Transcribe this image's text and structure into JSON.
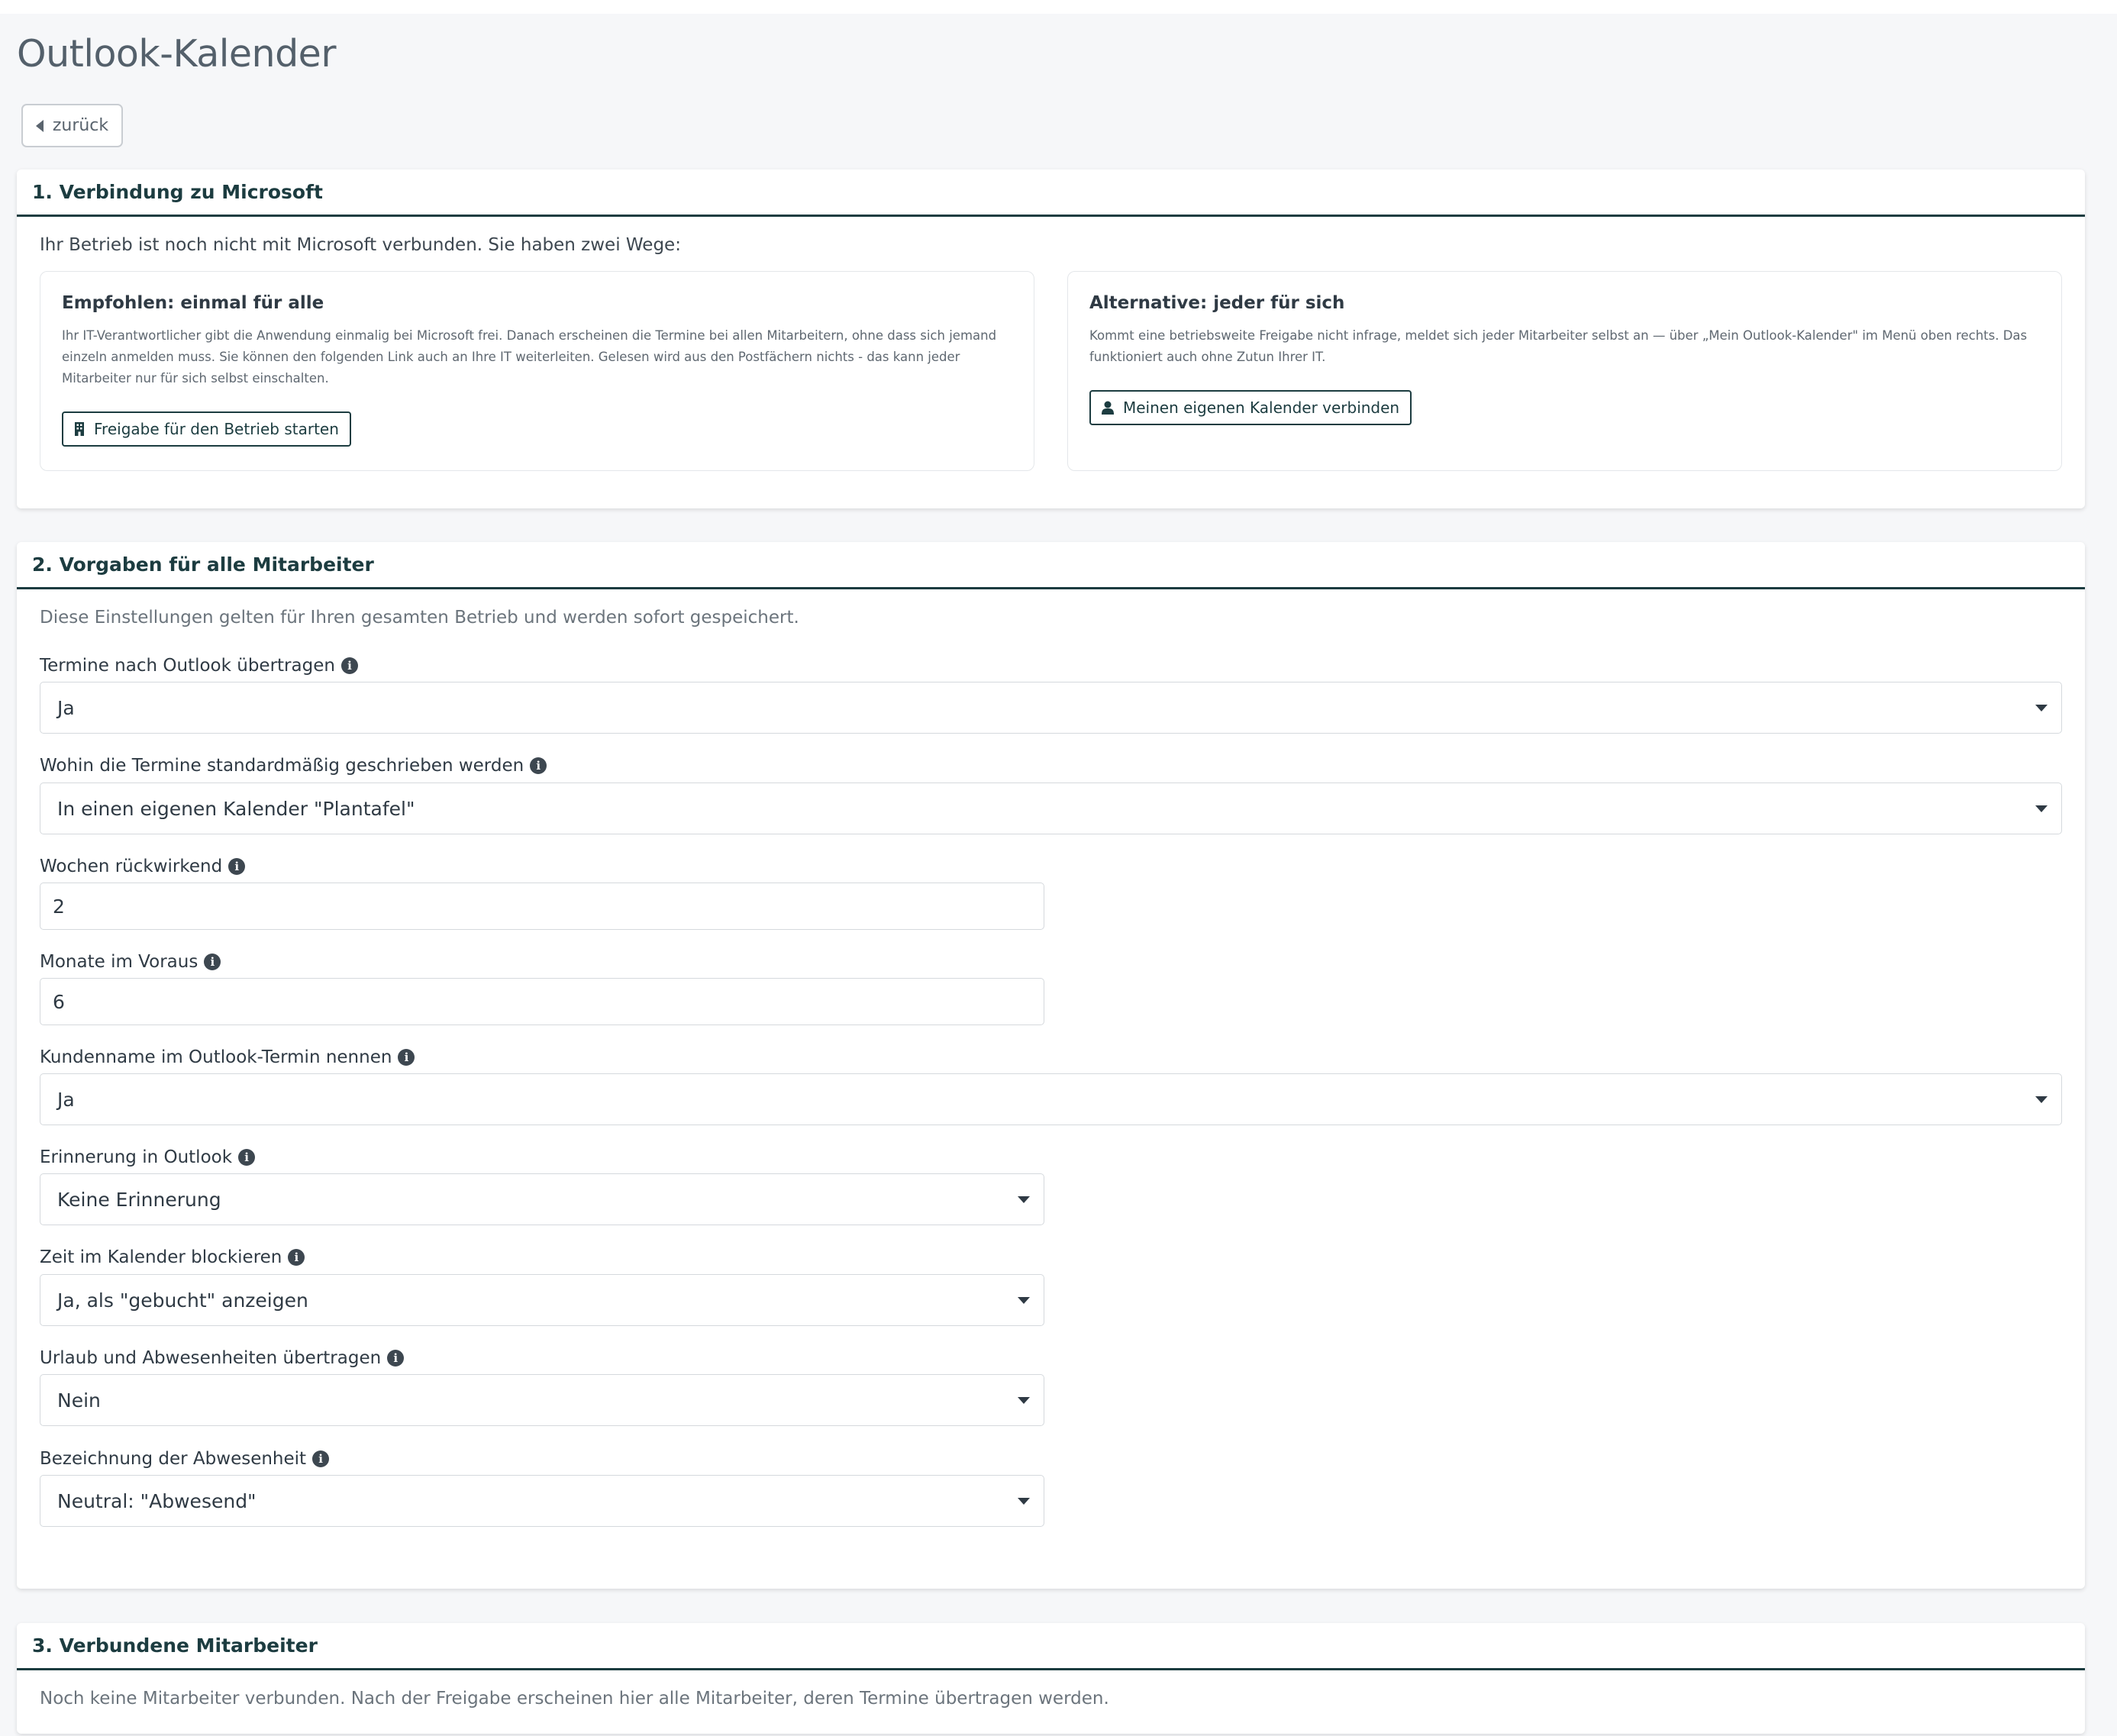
{
  "page": {
    "title": "Outlook-Kalender",
    "back_label": "zurück"
  },
  "section1": {
    "heading": "1. Verbindung zu Microsoft",
    "intro": "Ihr Betrieb ist noch nicht mit Microsoft verbunden. Sie haben zwei Wege:",
    "recommended": {
      "title": "Empfohlen: einmal für alle",
      "line1": "Ihr IT-Verantwortlicher gibt die Anwendung einmalig bei Microsoft frei. Danach erscheinen die Termine bei allen Mitarbeitern, ohne dass sich jemand",
      "line2": "einzeln anmelden muss. Sie können den folgenden Link auch an Ihre IT weiterleiten. Gelesen wird aus den Postfächern nichts - das kann jeder",
      "line3": "Mitarbeiter nur für sich selbst einschalten.",
      "button": "Freigabe für den Betrieb starten",
      "button_icon": "building-icon"
    },
    "alternative": {
      "title": "Alternative: jeder für sich",
      "line1": "Kommt eine betriebsweite Freigabe nicht infrage, meldet sich jeder Mitarbeiter selbst an — über „Mein Outlook-Kalender\" im Menü oben rechts. Das",
      "line2": "funktioniert auch ohne Zutun Ihrer IT.",
      "button": "Meinen eigenen Kalender verbinden",
      "button_icon": "user-icon"
    }
  },
  "section2": {
    "heading": "2. Vorgaben für alle Mitarbeiter",
    "intro": "Diese Einstellungen gelten für Ihren gesamten Betrieb und werden sofort gespeichert.",
    "fields": [
      {
        "label": "Termine nach Outlook übertragen",
        "value": "Ja",
        "type": "select"
      },
      {
        "label": "Wohin die Termine standardmäßig geschrieben werden",
        "value": "In einen eigenen Kalender \"Plantafel\"",
        "type": "select"
      },
      {
        "label": "Wochen rückwirkend",
        "value": "2",
        "type": "input"
      },
      {
        "label": "Monate im Voraus",
        "value": "6",
        "type": "input"
      },
      {
        "label": "Kundenname im Outlook-Termin nennen",
        "value": "Ja",
        "type": "select"
      },
      {
        "label": "Erinnerung in Outlook",
        "value": "Keine Erinnerung",
        "type": "select"
      },
      {
        "label": "Zeit im Kalender blockieren",
        "value": "Ja, als \"gebucht\" anzeigen",
        "type": "select"
      },
      {
        "label": "Urlaub und Abwesenheiten übertragen",
        "value": "Nein",
        "type": "select"
      },
      {
        "label": "Bezeichnung der Abwesenheit",
        "value": "Neutral: \"Abwesend\"",
        "type": "select"
      }
    ]
  },
  "section3": {
    "heading": "3. Verbundene Mitarbeiter",
    "empty_text": "Noch keine Mitarbeiter verbunden. Nach der Freigabe erscheinen hier alle Mitarbeiter, deren Termine übertragen werden."
  },
  "colors": {
    "accent": "#1c3c40",
    "background": "#f6f7f9"
  }
}
